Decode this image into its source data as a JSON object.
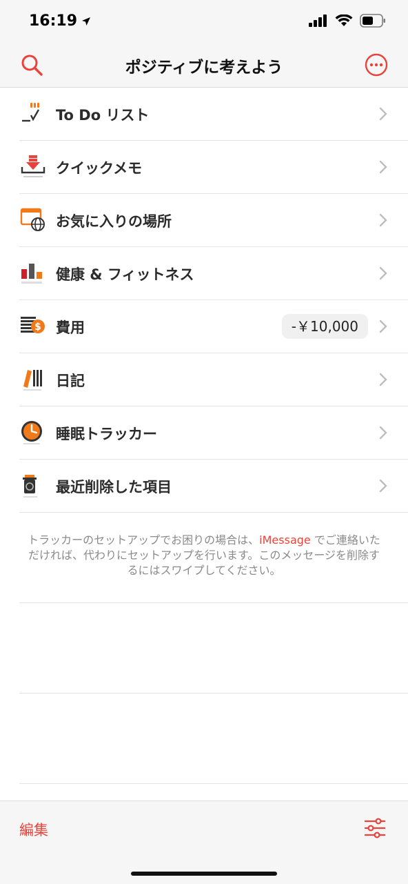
{
  "status": {
    "time": "16:19"
  },
  "nav": {
    "title": "ポジティブに考えよう"
  },
  "items": [
    {
      "label": "To Do リスト"
    },
    {
      "label": "クイックメモ"
    },
    {
      "label": "お気に入りの場所"
    },
    {
      "label": "健康 & フィットネス"
    },
    {
      "label": "費用",
      "badge": "-￥10,000"
    },
    {
      "label": "日記"
    },
    {
      "label": "睡眠トラッカー"
    },
    {
      "label": "最近削除した項目"
    }
  ],
  "notice": {
    "before": "トラッカーのセットアップでお困りの場合は、",
    "link": "iMessage",
    "after": " でご連絡いただければ、代わりにセットアップを行います。このメッセージを削除するにはスワイプしてください。"
  },
  "toolbar": {
    "edit_label": "編集"
  },
  "colors": {
    "accent": "#e8433b",
    "orange": "#f07a1a"
  }
}
